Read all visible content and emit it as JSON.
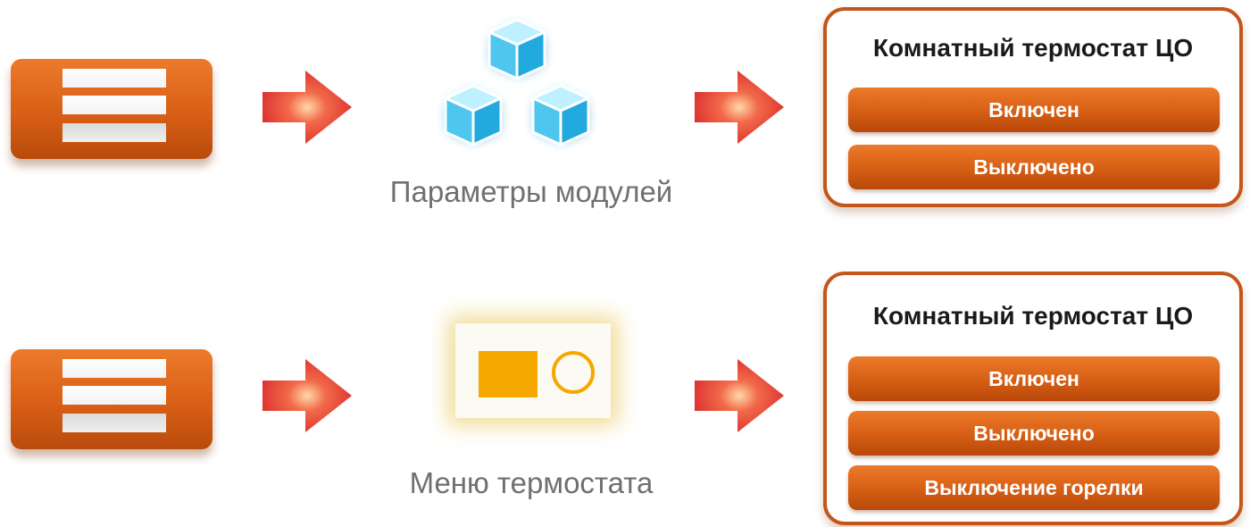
{
  "rows": [
    {
      "caption": "Параметры модулей",
      "icon": "cubes-icon",
      "panel": {
        "title": "Комнатный термостат ЦО",
        "options": [
          "Включен",
          "Выключено"
        ]
      }
    },
    {
      "caption": "Меню термостата",
      "icon": "thermostat-device-icon",
      "panel": {
        "title": "Комнатный термостат ЦО",
        "options": [
          "Включен",
          "Выключено",
          "Выключение горелки"
        ]
      }
    }
  ],
  "colors": {
    "accent_orange": "#d85f16",
    "panel_border": "#c4561a",
    "arrow_red": "#e5322b",
    "cube_blue": "#4fc6ee",
    "device_yellow": "#f5a800",
    "caption_gray": "#707070"
  }
}
